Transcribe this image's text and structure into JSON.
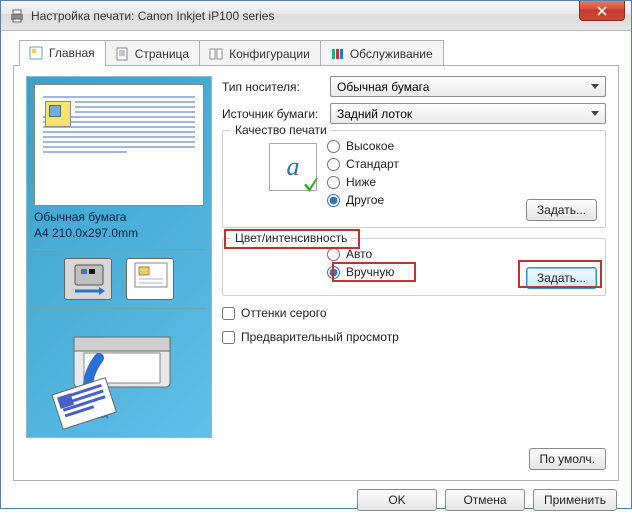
{
  "window": {
    "title": "Настройка печати: Canon Inkjet iP100 series"
  },
  "tabs": {
    "main": "Главная",
    "page": "Страница",
    "config": "Конфигурации",
    "maint": "Обслуживание"
  },
  "preview": {
    "media": "Обычная бумага",
    "size": "A4 210.0x297.0mm"
  },
  "labels": {
    "mediaType": "Тип носителя:",
    "paperSource": "Источник бумаги:",
    "quality": "Качество печати",
    "colorIntensity": "Цвет/интенсивность",
    "grayscale": "Оттенки серого",
    "previewChk": "Предварительный просмотр"
  },
  "selects": {
    "mediaType": "Обычная бумага",
    "paperSource": "Задний лоток"
  },
  "quality": {
    "high": "Высокое",
    "standard": "Стандарт",
    "low": "Ниже",
    "other": "Другое",
    "set": "Задать..."
  },
  "color": {
    "auto": "Авто",
    "manual": "Вручную",
    "set": "Задать..."
  },
  "buttons": {
    "defaults": "По умолч.",
    "ok": "OK",
    "cancel": "Отмена",
    "apply": "Применить"
  }
}
